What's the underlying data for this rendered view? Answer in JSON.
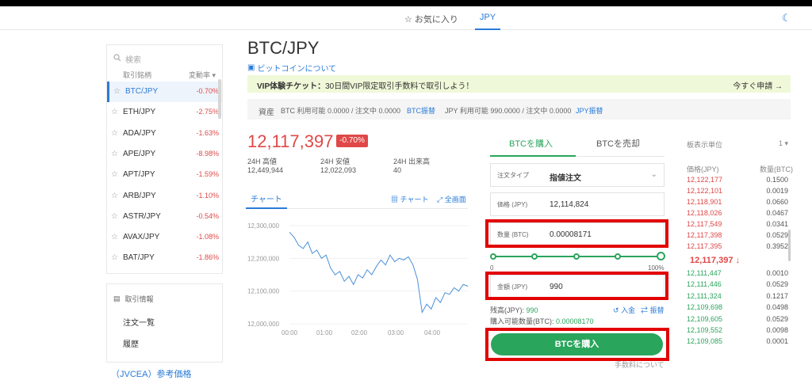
{
  "topnav": {
    "favorites": "お気に入り",
    "jpy_tab": "JPY"
  },
  "sidebar": {
    "search_placeholder": "検索",
    "col_name": "取引銘柄",
    "col_change": "変動率",
    "items": [
      {
        "name": "BTC/JPY",
        "change": "-0.70%"
      },
      {
        "name": "ETH/JPY",
        "change": "-2.75%"
      },
      {
        "name": "ADA/JPY",
        "change": "-1.63%"
      },
      {
        "name": "APE/JPY",
        "change": "-8.98%"
      },
      {
        "name": "APT/JPY",
        "change": "-1.59%"
      },
      {
        "name": "ARB/JPY",
        "change": "-1.10%"
      },
      {
        "name": "ASTR/JPY",
        "change": "-0.54%"
      },
      {
        "name": "AVAX/JPY",
        "change": "-1.08%"
      },
      {
        "name": "BAT/JPY",
        "change": "-1.86%"
      }
    ],
    "info_title": "取引情報",
    "info_items": [
      "注文一覧",
      "履歴"
    ],
    "jvcea": "（JVCEA）参考価格"
  },
  "main": {
    "pair": "BTC/JPY",
    "about": "ビットコインについて",
    "banner_bold": "VIP体験チケット：",
    "banner_text": "30日間VIP限定取引手数料で取引しよう！",
    "banner_action": "今すぐ申請 →",
    "assets": {
      "label": "資産",
      "btc": "BTC  利用可能 0.0000 / 注文中 0.0000",
      "btc_link": "BTC振替",
      "jpy": "JPY  利用可能 990.0000 / 注文中 0.0000",
      "jpy_link": "JPY振替"
    },
    "price": "12,117,397",
    "change": "-0.70%",
    "stats": [
      {
        "label": "24H 高値",
        "value": "12,449,944"
      },
      {
        "label": "24H 安値",
        "value": "12,022,093"
      },
      {
        "label": "24H 出来高",
        "value": "40"
      }
    ],
    "chart_tab": "チャート",
    "chart_link": "チャート",
    "fullscreen_link": "全画面"
  },
  "chart_data": {
    "type": "line",
    "x_ticks": [
      "00:00",
      "01:00",
      "02:00",
      "03:00",
      "04:00"
    ],
    "y_ticks": [
      "12,300,000",
      "12,200,000",
      "12,100,000",
      "12,000,000"
    ],
    "ylim": [
      12000000,
      12300000
    ],
    "values": [
      12280000,
      12265000,
      12240000,
      12230000,
      12250000,
      12215000,
      12225000,
      12200000,
      12210000,
      12170000,
      12150000,
      12160000,
      12130000,
      12145000,
      12120000,
      12150000,
      12140000,
      12165000,
      12150000,
      12175000,
      12195000,
      12180000,
      12210000,
      12190000,
      12200000,
      12195000,
      12205000,
      12180000,
      12135000,
      12035000,
      12060000,
      12045000,
      12080000,
      12065000,
      12095000,
      12090000,
      12110000,
      12100000,
      12120000,
      12115000
    ],
    "line_color": "#4a90d9"
  },
  "order": {
    "buy_tab": "BTCを購入",
    "sell_tab": "BTCを売却",
    "type_label": "注文タイプ",
    "type_value": "指値注文",
    "price_label": "価格 (JPY)",
    "price_value": "12,114,824",
    "qty_label": "数量 (BTC)",
    "qty_value": "0.00008171",
    "slider_min": "0",
    "slider_max": "100%",
    "slider_pct": 1.0,
    "amount_label": "金額 (JPY)",
    "amount_value": "990",
    "balance_label": "残高(JPY):",
    "balance_value": "990",
    "deposit": "入金",
    "transfer": "振替",
    "max_buy_label": "購入可能数量(BTC):",
    "max_buy_value": "0.00008170",
    "buy_button": "BTCを購入",
    "fee": "手数料について"
  },
  "orderbook": {
    "unit_label": "板表示単位",
    "unit_value": "1",
    "col_price": "価格(JPY)",
    "col_qty": "数量(BTC)",
    "asks": [
      {
        "p": "12,122,177",
        "q": "0.1500"
      },
      {
        "p": "12,122,101",
        "q": "0.0019"
      },
      {
        "p": "12,118,901",
        "q": "0.0660"
      },
      {
        "p": "12,118,026",
        "q": "0.0467"
      },
      {
        "p": "12,117,549",
        "q": "0.0341"
      },
      {
        "p": "12,117,398",
        "q": "0.0529"
      },
      {
        "p": "12,117,395",
        "q": "0.3952"
      }
    ],
    "mid": "12,117,397 ↓",
    "bids": [
      {
        "p": "12,111,447",
        "q": "0.0010"
      },
      {
        "p": "12,111,446",
        "q": "0.0529"
      },
      {
        "p": "12,111,324",
        "q": "0.1217"
      },
      {
        "p": "12,109,698",
        "q": "0.0498"
      },
      {
        "p": "12,109,605",
        "q": "0.0529"
      },
      {
        "p": "12,109,552",
        "q": "0.0098"
      },
      {
        "p": "12,109,085",
        "q": "0.0001"
      }
    ]
  }
}
